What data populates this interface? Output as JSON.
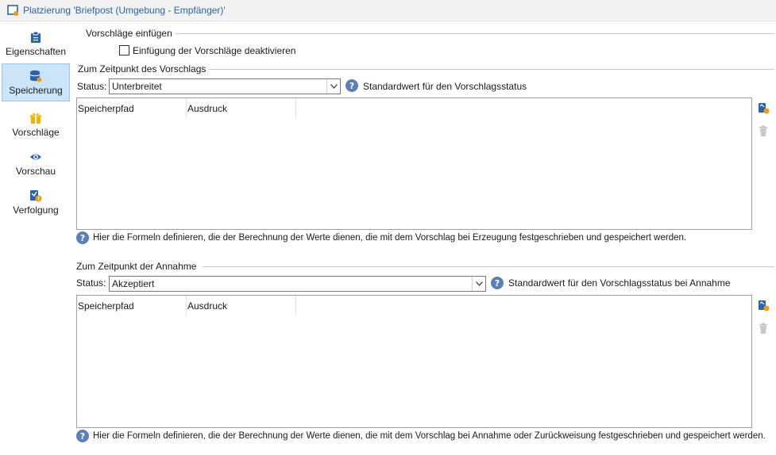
{
  "window": {
    "title": "Platzierung 'Briefpost (Umgebung - Empfänger)'",
    "icon": "placement-icon"
  },
  "sidebar": {
    "items": [
      {
        "label": "Eigenschaften",
        "icon": "clipboard-icon",
        "active": false
      },
      {
        "label": "Speicherung",
        "icon": "database-icon",
        "active": true
      },
      {
        "label": "Vorschläge",
        "icon": "gift-icon",
        "active": false
      },
      {
        "label": "Vorschau",
        "icon": "eye-icon",
        "active": false
      },
      {
        "label": "Verfolgung",
        "icon": "tracking-icon",
        "active": false
      }
    ]
  },
  "insert": {
    "group_label": "Vorschläge einfügen",
    "checkbox_label": "Einfügung der Vorschläge deaktivieren",
    "checked": false
  },
  "proposal": {
    "group_label": "Zum Zeitpunkt des Vorschlags",
    "status_label": "Status:",
    "status_value": "Unterbreitet",
    "status_help": "Standardwert für den Vorschlagsstatus",
    "columns": [
      "Speicherpfad",
      "Ausdruck"
    ],
    "note": "Hier die Formeln definieren, die der Berechnung der Werte dienen, die mit dem Vorschlag bei Erzeugung festgeschrieben und gespeichert werden."
  },
  "acceptance": {
    "group_label": "Zum Zeitpunkt der Annahme",
    "status_label": "Status:",
    "status_value": "Akzeptiert",
    "status_help": "Standardwert für den Vorschlagsstatus bei Annahme",
    "columns": [
      "Speicherpfad",
      "Ausdruck"
    ],
    "note": "Hier die Formeln definieren, die der Berechnung der Werte dienen, die mit dem Vorschlag bei Annahme oder Zurückweisung festgeschrieben und gespeichert werden."
  },
  "colors": {
    "accent": "#2a62ac",
    "active_bg": "#cce4f7",
    "help_bg": "#5b7fb9"
  }
}
